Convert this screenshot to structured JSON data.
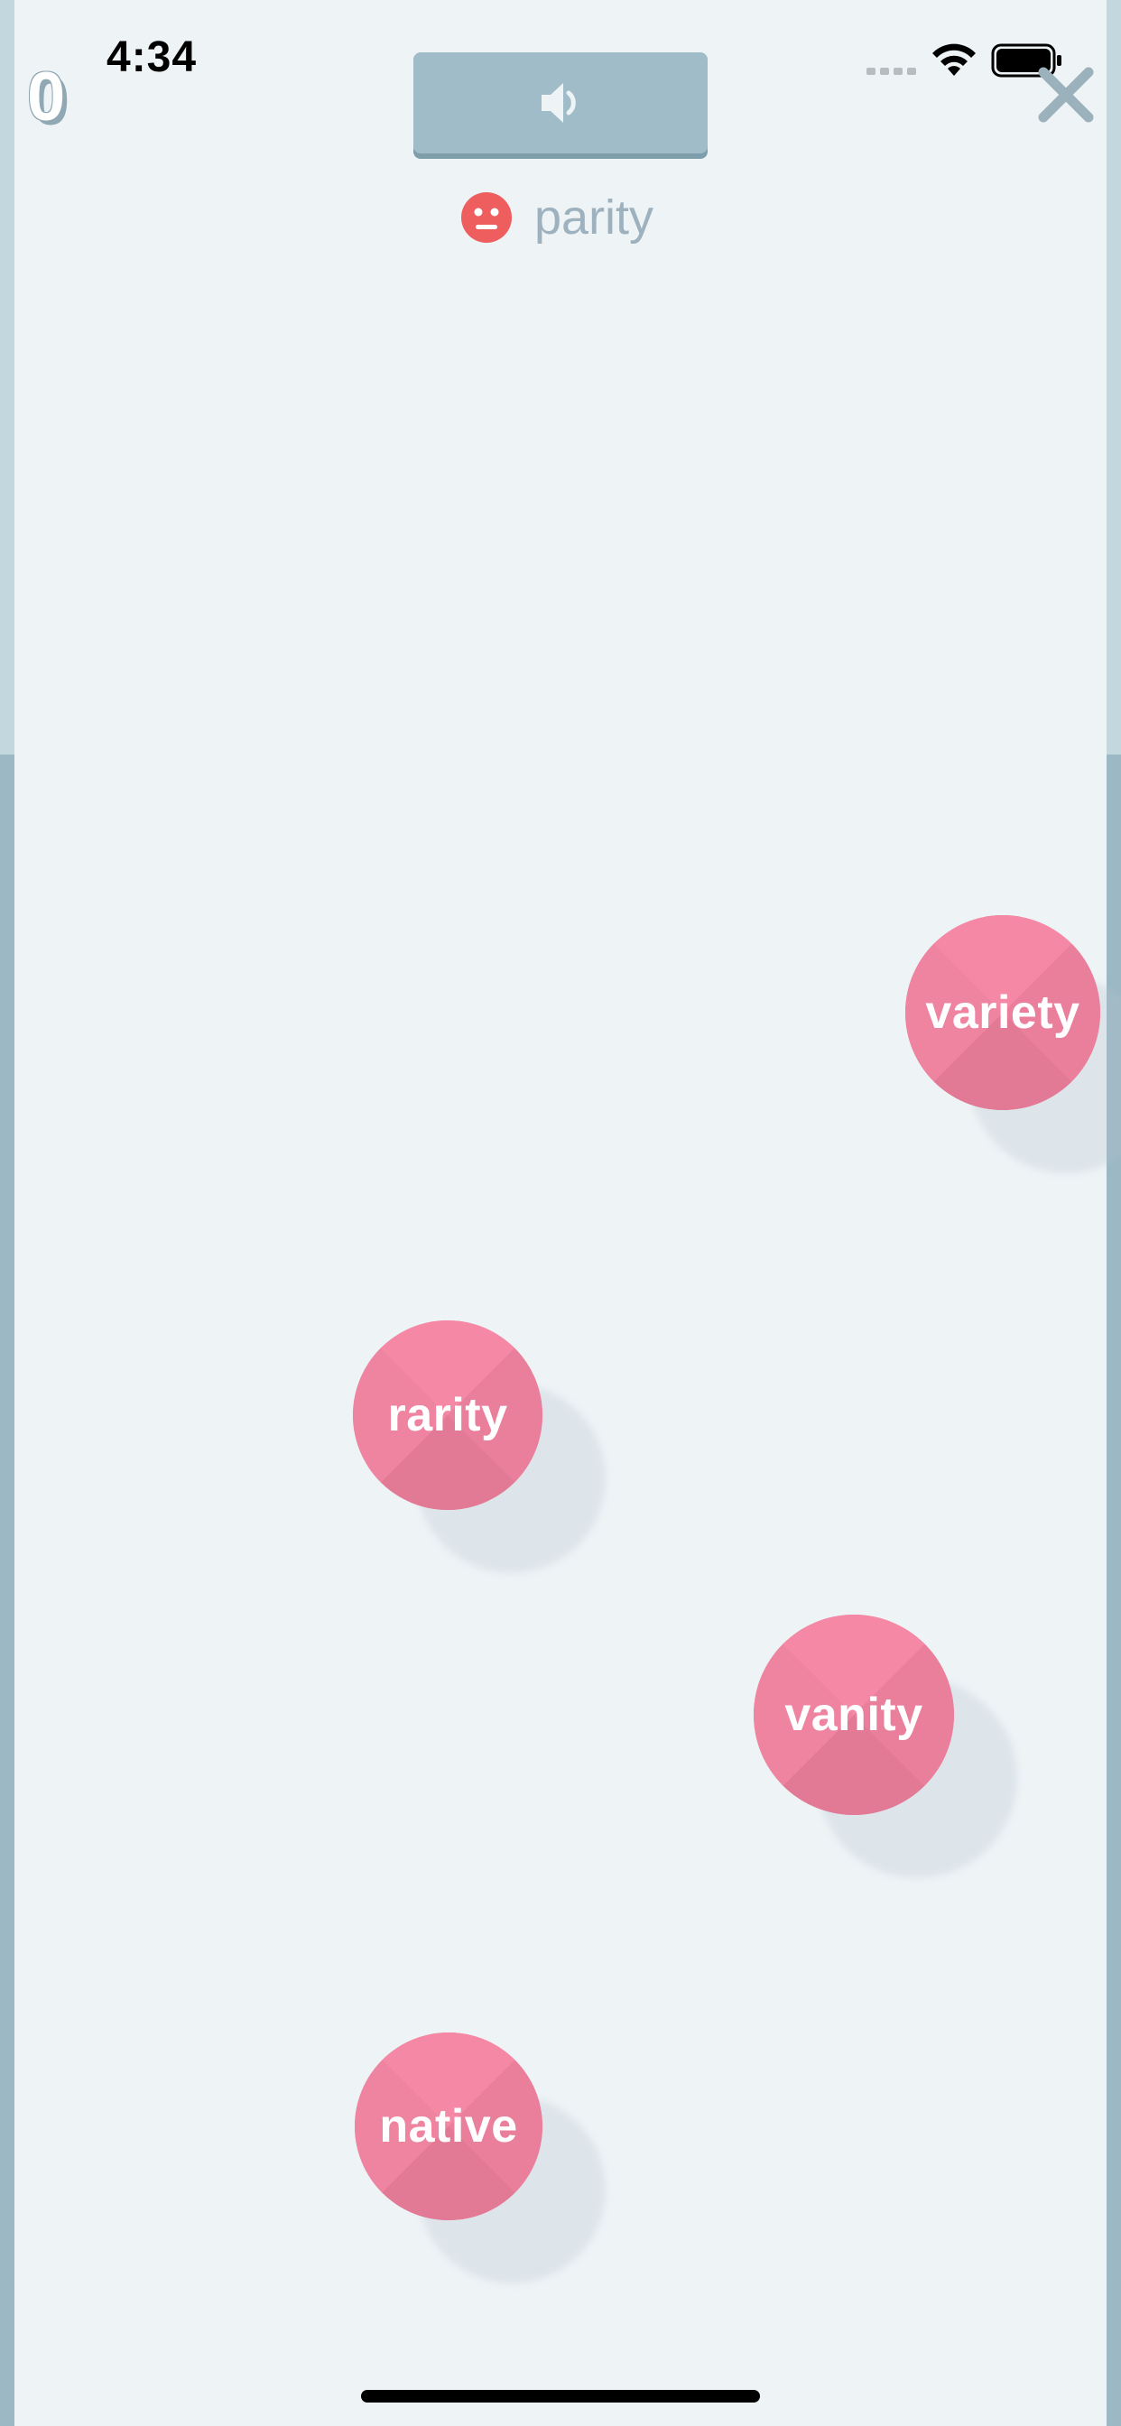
{
  "status_bar": {
    "time": "4:34"
  },
  "game": {
    "score": "0",
    "prompt_word": "parity",
    "audio_button_icon": "speaker-icon",
    "close_icon": "close-icon",
    "feedback_icon": "sad-face-icon"
  },
  "bubbles": [
    {
      "label": "variety"
    },
    {
      "label": "rarity"
    },
    {
      "label": "vanity"
    },
    {
      "label": "native"
    }
  ],
  "colors": {
    "background": "#eef3f6",
    "bubble": "#ec809d",
    "audio_button": "#9fbcc8",
    "sad_face": "#ef5e5e",
    "prompt_text": "#9db2be"
  }
}
